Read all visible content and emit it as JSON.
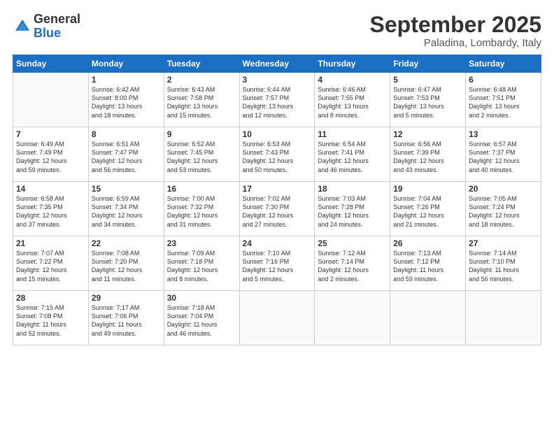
{
  "logo": {
    "general": "General",
    "blue": "Blue"
  },
  "title": "September 2025",
  "location": "Paladina, Lombardy, Italy",
  "days_header": [
    "Sunday",
    "Monday",
    "Tuesday",
    "Wednesday",
    "Thursday",
    "Friday",
    "Saturday"
  ],
  "weeks": [
    [
      {
        "day": "",
        "info": ""
      },
      {
        "day": "1",
        "info": "Sunrise: 6:42 AM\nSunset: 8:00 PM\nDaylight: 13 hours\nand 18 minutes."
      },
      {
        "day": "2",
        "info": "Sunrise: 6:43 AM\nSunset: 7:58 PM\nDaylight: 13 hours\nand 15 minutes."
      },
      {
        "day": "3",
        "info": "Sunrise: 6:44 AM\nSunset: 7:57 PM\nDaylight: 13 hours\nand 12 minutes."
      },
      {
        "day": "4",
        "info": "Sunrise: 6:46 AM\nSunset: 7:55 PM\nDaylight: 13 hours\nand 8 minutes."
      },
      {
        "day": "5",
        "info": "Sunrise: 6:47 AM\nSunset: 7:53 PM\nDaylight: 13 hours\nand 5 minutes."
      },
      {
        "day": "6",
        "info": "Sunrise: 6:48 AM\nSunset: 7:51 PM\nDaylight: 13 hours\nand 2 minutes."
      }
    ],
    [
      {
        "day": "7",
        "info": "Sunrise: 6:49 AM\nSunset: 7:49 PM\nDaylight: 12 hours\nand 59 minutes."
      },
      {
        "day": "8",
        "info": "Sunrise: 6:51 AM\nSunset: 7:47 PM\nDaylight: 12 hours\nand 56 minutes."
      },
      {
        "day": "9",
        "info": "Sunrise: 6:52 AM\nSunset: 7:45 PM\nDaylight: 12 hours\nand 53 minutes."
      },
      {
        "day": "10",
        "info": "Sunrise: 6:53 AM\nSunset: 7:43 PM\nDaylight: 12 hours\nand 50 minutes."
      },
      {
        "day": "11",
        "info": "Sunrise: 6:54 AM\nSunset: 7:41 PM\nDaylight: 12 hours\nand 46 minutes."
      },
      {
        "day": "12",
        "info": "Sunrise: 6:56 AM\nSunset: 7:39 PM\nDaylight: 12 hours\nand 43 minutes."
      },
      {
        "day": "13",
        "info": "Sunrise: 6:57 AM\nSunset: 7:37 PM\nDaylight: 12 hours\nand 40 minutes."
      }
    ],
    [
      {
        "day": "14",
        "info": "Sunrise: 6:58 AM\nSunset: 7:35 PM\nDaylight: 12 hours\nand 37 minutes."
      },
      {
        "day": "15",
        "info": "Sunrise: 6:59 AM\nSunset: 7:34 PM\nDaylight: 12 hours\nand 34 minutes."
      },
      {
        "day": "16",
        "info": "Sunrise: 7:00 AM\nSunset: 7:32 PM\nDaylight: 12 hours\nand 31 minutes."
      },
      {
        "day": "17",
        "info": "Sunrise: 7:02 AM\nSunset: 7:30 PM\nDaylight: 12 hours\nand 27 minutes."
      },
      {
        "day": "18",
        "info": "Sunrise: 7:03 AM\nSunset: 7:28 PM\nDaylight: 12 hours\nand 24 minutes."
      },
      {
        "day": "19",
        "info": "Sunrise: 7:04 AM\nSunset: 7:26 PM\nDaylight: 12 hours\nand 21 minutes."
      },
      {
        "day": "20",
        "info": "Sunrise: 7:05 AM\nSunset: 7:24 PM\nDaylight: 12 hours\nand 18 minutes."
      }
    ],
    [
      {
        "day": "21",
        "info": "Sunrise: 7:07 AM\nSunset: 7:22 PM\nDaylight: 12 hours\nand 15 minutes."
      },
      {
        "day": "22",
        "info": "Sunrise: 7:08 AM\nSunset: 7:20 PM\nDaylight: 12 hours\nand 11 minutes."
      },
      {
        "day": "23",
        "info": "Sunrise: 7:09 AM\nSunset: 7:18 PM\nDaylight: 12 hours\nand 8 minutes."
      },
      {
        "day": "24",
        "info": "Sunrise: 7:10 AM\nSunset: 7:16 PM\nDaylight: 12 hours\nand 5 minutes."
      },
      {
        "day": "25",
        "info": "Sunrise: 7:12 AM\nSunset: 7:14 PM\nDaylight: 12 hours\nand 2 minutes."
      },
      {
        "day": "26",
        "info": "Sunrise: 7:13 AM\nSunset: 7:12 PM\nDaylight: 11 hours\nand 59 minutes."
      },
      {
        "day": "27",
        "info": "Sunrise: 7:14 AM\nSunset: 7:10 PM\nDaylight: 11 hours\nand 56 minutes."
      }
    ],
    [
      {
        "day": "28",
        "info": "Sunrise: 7:15 AM\nSunset: 7:08 PM\nDaylight: 11 hours\nand 52 minutes."
      },
      {
        "day": "29",
        "info": "Sunrise: 7:17 AM\nSunset: 7:06 PM\nDaylight: 11 hours\nand 49 minutes."
      },
      {
        "day": "30",
        "info": "Sunrise: 7:18 AM\nSunset: 7:04 PM\nDaylight: 11 hours\nand 46 minutes."
      },
      {
        "day": "",
        "info": ""
      },
      {
        "day": "",
        "info": ""
      },
      {
        "day": "",
        "info": ""
      },
      {
        "day": "",
        "info": ""
      }
    ]
  ]
}
